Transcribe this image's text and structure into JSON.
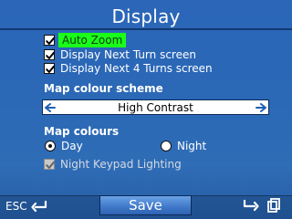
{
  "header": {
    "title": "Display"
  },
  "options": {
    "auto_zoom": "Auto Zoom",
    "next_turn": "Display Next Turn screen",
    "next_4_turns": "Display Next 4 Turns screen"
  },
  "colour_scheme": {
    "label": "Map colour scheme",
    "value": "High Contrast"
  },
  "map_colours": {
    "label": "Map colours",
    "day": "Day",
    "night": "Night",
    "selected": "Day",
    "night_keypad": "Night Keypad Lighting"
  },
  "footer": {
    "esc": "ESC",
    "save": "Save"
  },
  "colors": {
    "background": "#2d6dc0",
    "highlight": "#1aff1a",
    "select_arrow": "#1f5fb5"
  },
  "icons": {
    "back": "return-arrow-icon",
    "left": "arrow-left-icon",
    "right": "arrow-right-icon",
    "forward": "forward-arrow-icon",
    "copy": "copy-icon"
  }
}
